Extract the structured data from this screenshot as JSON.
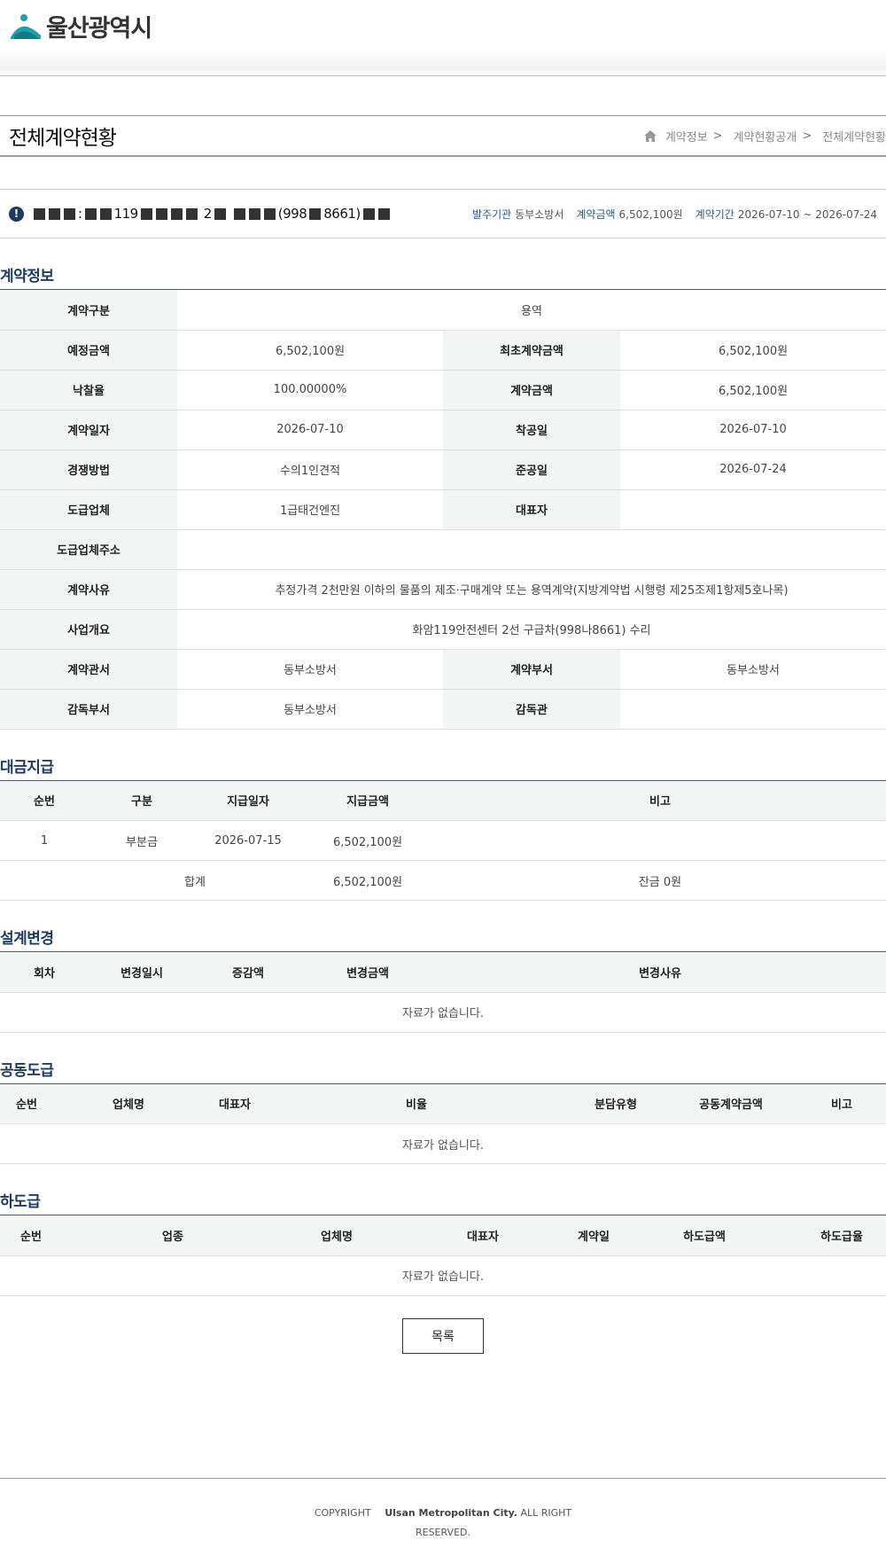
{
  "header": {
    "logo_text": "울산광역시"
  },
  "title_bar": {
    "title": "전체계약현황",
    "breadcrumb": [
      "계약정보",
      "계약현황공개",
      "전체계약현황"
    ],
    "breadcrumb_sep": ">"
  },
  "summary": {
    "title_parts": [
      ":",
      "119",
      "2",
      "(998",
      "8661)"
    ],
    "issuer_label": "발주기관",
    "issuer_value": "동부소방서",
    "amount_label": "계약금액",
    "amount_value": "6,502,100원",
    "period_label": "계약기간",
    "period_value": "2026-07-10 ~ 2026-07-24"
  },
  "contract_info": {
    "title": "계약정보",
    "rows": [
      {
        "l1": "계약구분",
        "v1": "용역"
      },
      {
        "l1": "예정금액",
        "v1": "6,502,100원",
        "l2": "최초계약금액",
        "v2": "6,502,100원"
      },
      {
        "l1": "낙찰율",
        "v1": "100.00000%",
        "l2": "계약금액",
        "v2": "6,502,100원"
      },
      {
        "l1": "계약일자",
        "v1": "2026-07-10",
        "l2": "착공일",
        "v2": "2026-07-10"
      },
      {
        "l1": "경쟁방법",
        "v1": "수의1인견적",
        "l2": "준공일",
        "v2": "2026-07-24"
      },
      {
        "l1": "도급업체",
        "v1": "1급태건엔진",
        "l2": "대표자",
        "v2": ""
      },
      {
        "l1": "도급업체주소",
        "v1": ""
      },
      {
        "l1": "계약사유",
        "v1": "추정가격 2천만원 이하의 물품의 제조·구매계약 또는 용역계약(지방계약법 시행령 제25조제1항제5호나목)"
      },
      {
        "l1": "사업개요",
        "v1": "화암119안전센터 2선 구급차(998나8661) 수리"
      },
      {
        "l1": "계약관서",
        "v1": "동부소방서",
        "l2": "계약부서",
        "v2": "동부소방서"
      },
      {
        "l1": "감독부서",
        "v1": "동부소방서",
        "l2": "감독관",
        "v2": ""
      }
    ]
  },
  "payment": {
    "title": "대금지급",
    "headers": [
      "순번",
      "구분",
      "지급일자",
      "지급금액",
      "비고"
    ],
    "row": [
      "1",
      "부분금",
      "2026-07-15",
      "6,502,100원",
      ""
    ],
    "total_label": "합계",
    "total_amount": "6,502,100원",
    "total_note": "잔금 0원"
  },
  "design_change": {
    "title": "설계변경",
    "headers": [
      "회차",
      "변경일시",
      "증감액",
      "변경금액",
      "변경사유"
    ],
    "empty": "자료가 없습니다."
  },
  "joint": {
    "title": "공동도급",
    "headers": [
      "순번",
      "업체명",
      "대표자",
      "비율",
      "분담유형",
      "공동계약금액",
      "비고"
    ],
    "empty": "자료가 없습니다."
  },
  "subcontract": {
    "title": "하도급",
    "headers": [
      "순번",
      "업종",
      "업체명",
      "대표자",
      "계약일",
      "하도급액",
      "하도급율"
    ],
    "empty": "자료가 없습니다."
  },
  "list_button": "목록",
  "footer": {
    "copyright": "COPYRIGHT",
    "org": "Ulsan Metropolitan City.",
    "rights": "ALL RIGHT",
    "reserved": "RESERVED."
  },
  "colors": {
    "accent": "#1f3b5c",
    "header_bg": "#f3f4f4",
    "logo_teal": "#1aa3a8"
  }
}
